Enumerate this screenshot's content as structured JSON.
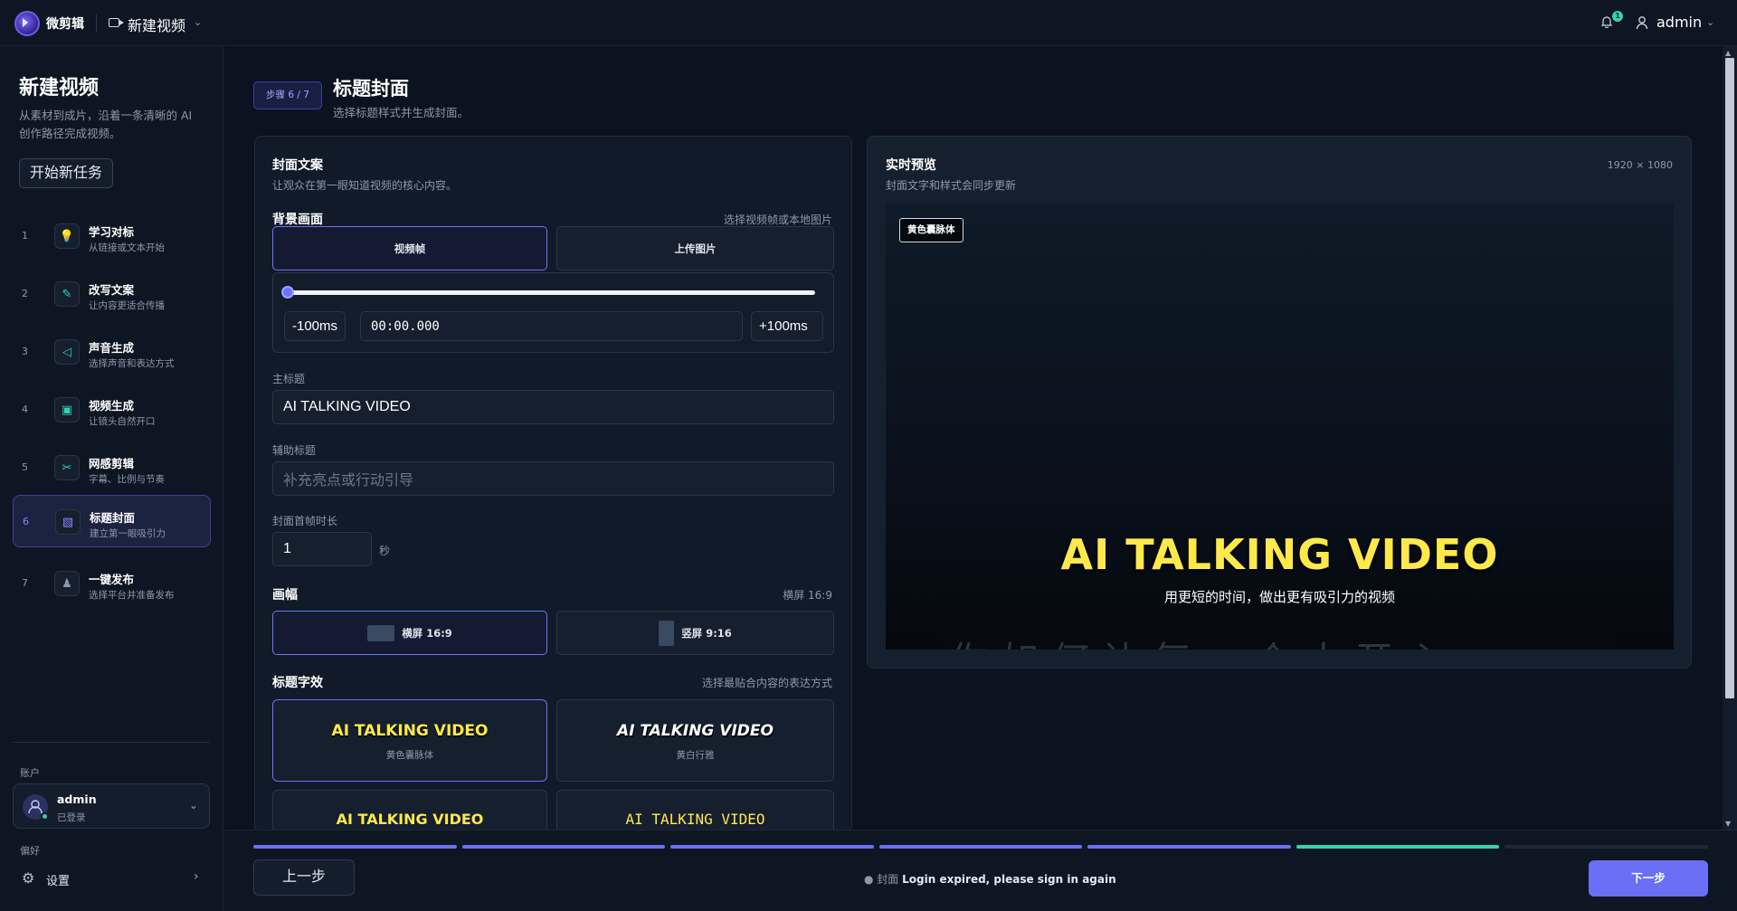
{
  "header": {
    "brand": "微剪辑",
    "project_name": "新建视频",
    "notification_count": "1",
    "user": "admin"
  },
  "sidebar": {
    "title": "新建视频",
    "description": "从素材到成片，沿着一条清晰的 AI 创作路径完成视频。",
    "new_task_label": "开始新任务",
    "steps": [
      {
        "num": "1",
        "label": "学习对标",
        "sub": "从链接或文本开始",
        "icon": "bulb-icon"
      },
      {
        "num": "2",
        "label": "改写文案",
        "sub": "让内容更适合传播",
        "icon": "pencil-icon"
      },
      {
        "num": "3",
        "label": "声音生成",
        "sub": "选择声音和表达方式",
        "icon": "play-icon"
      },
      {
        "num": "4",
        "label": "视频生成",
        "sub": "让镜头自然开口",
        "icon": "video-icon"
      },
      {
        "num": "5",
        "label": "网感剪辑",
        "sub": "字幕、比例与节奏",
        "icon": "scissors-icon"
      },
      {
        "num": "6",
        "label": "标题封面",
        "sub": "建立第一眼吸引力",
        "icon": "image-icon"
      },
      {
        "num": "7",
        "label": "一键发布",
        "sub": "选择平台并准备发布",
        "icon": "person-icon"
      }
    ],
    "active_step": 6,
    "account_label": "账户",
    "account_name": "admin",
    "account_status": "已登录",
    "preferences_label": "偏好",
    "settings_label": "设置"
  },
  "main": {
    "step_badge": "步骤 6 / 7",
    "title": "标题封面",
    "subtitle": "选择标题样式并生成封面。",
    "cover_text": {
      "title": "封面文案",
      "subtitle": "让观众在第一眼知道视频的核心内容。"
    },
    "background": {
      "title": "背景画面",
      "hint": "选择视频帧或本地图片",
      "options": [
        "视频帧",
        "上传图片"
      ],
      "selected": "视频帧",
      "slider_value": 0,
      "minus_label": "-100ms",
      "time_value": "00:00.000",
      "plus_label": "+100ms"
    },
    "main_title": {
      "label": "主标题",
      "value": "AI TALKING VIDEO"
    },
    "sub_title": {
      "label": "辅助标题",
      "value": "",
      "placeholder": "补充亮点或行动引导"
    },
    "duration": {
      "label": "封面首帧时长",
      "value": "1",
      "unit": "秒"
    },
    "aspect": {
      "title": "画幅",
      "hint": "横屏 16:9",
      "options": [
        "横屏 16:9",
        "竖屏 9:16"
      ],
      "selected": "横屏 16:9"
    },
    "effects": {
      "title": "标题字效",
      "hint": "选择最贴合内容的表达方式",
      "items": [
        {
          "text": "AI TALKING VIDEO",
          "name": "黄色囊脉体"
        },
        {
          "text": "AI TALKING VIDEO",
          "name": "黄白行雅"
        },
        {
          "text": "AI TALKING VIDEO",
          "name": ""
        },
        {
          "text": "AI TALKING VIDEO",
          "name": ""
        }
      ]
    }
  },
  "preview": {
    "title": "实时预览",
    "subtitle": "封面文字和样式会同步更新",
    "resolution": "1920 × 1080",
    "style_badge": "黄色囊脉体",
    "main_text": "AI TALKING VIDEO",
    "sub_text": "用更短的时间，做出更有吸引力的视频",
    "strip_text": "你如何让每一个人开心"
  },
  "footer": {
    "prev_label": "上一步",
    "status_prefix": "● 封面",
    "status_message": "Login expired, please sign in again",
    "next_label": "下一步",
    "progress_completed": 5,
    "progress_current": 6,
    "progress_total": 7
  },
  "colors": {
    "accent": "#6b6ff5",
    "teal": "#34d3b0",
    "title_yellow": "#ffe94a"
  }
}
